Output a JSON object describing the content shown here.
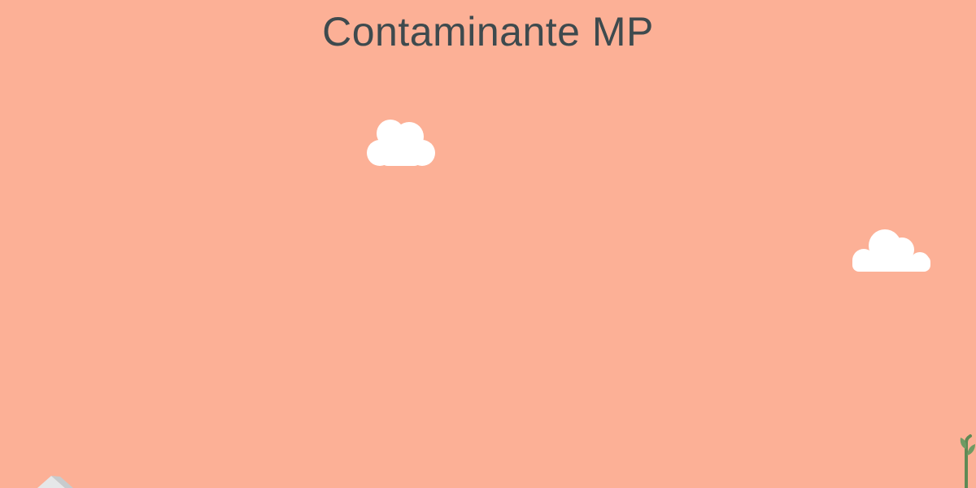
{
  "scene": {
    "title": "Contaminante MP",
    "background_color": "#FCB096",
    "title_color": "#3E4A4E"
  },
  "decorations": {
    "clouds": [
      "cloud-icon",
      "cloud-icon"
    ],
    "bottom_left": "building-roof-icon",
    "bottom_right": "plant-icon"
  }
}
